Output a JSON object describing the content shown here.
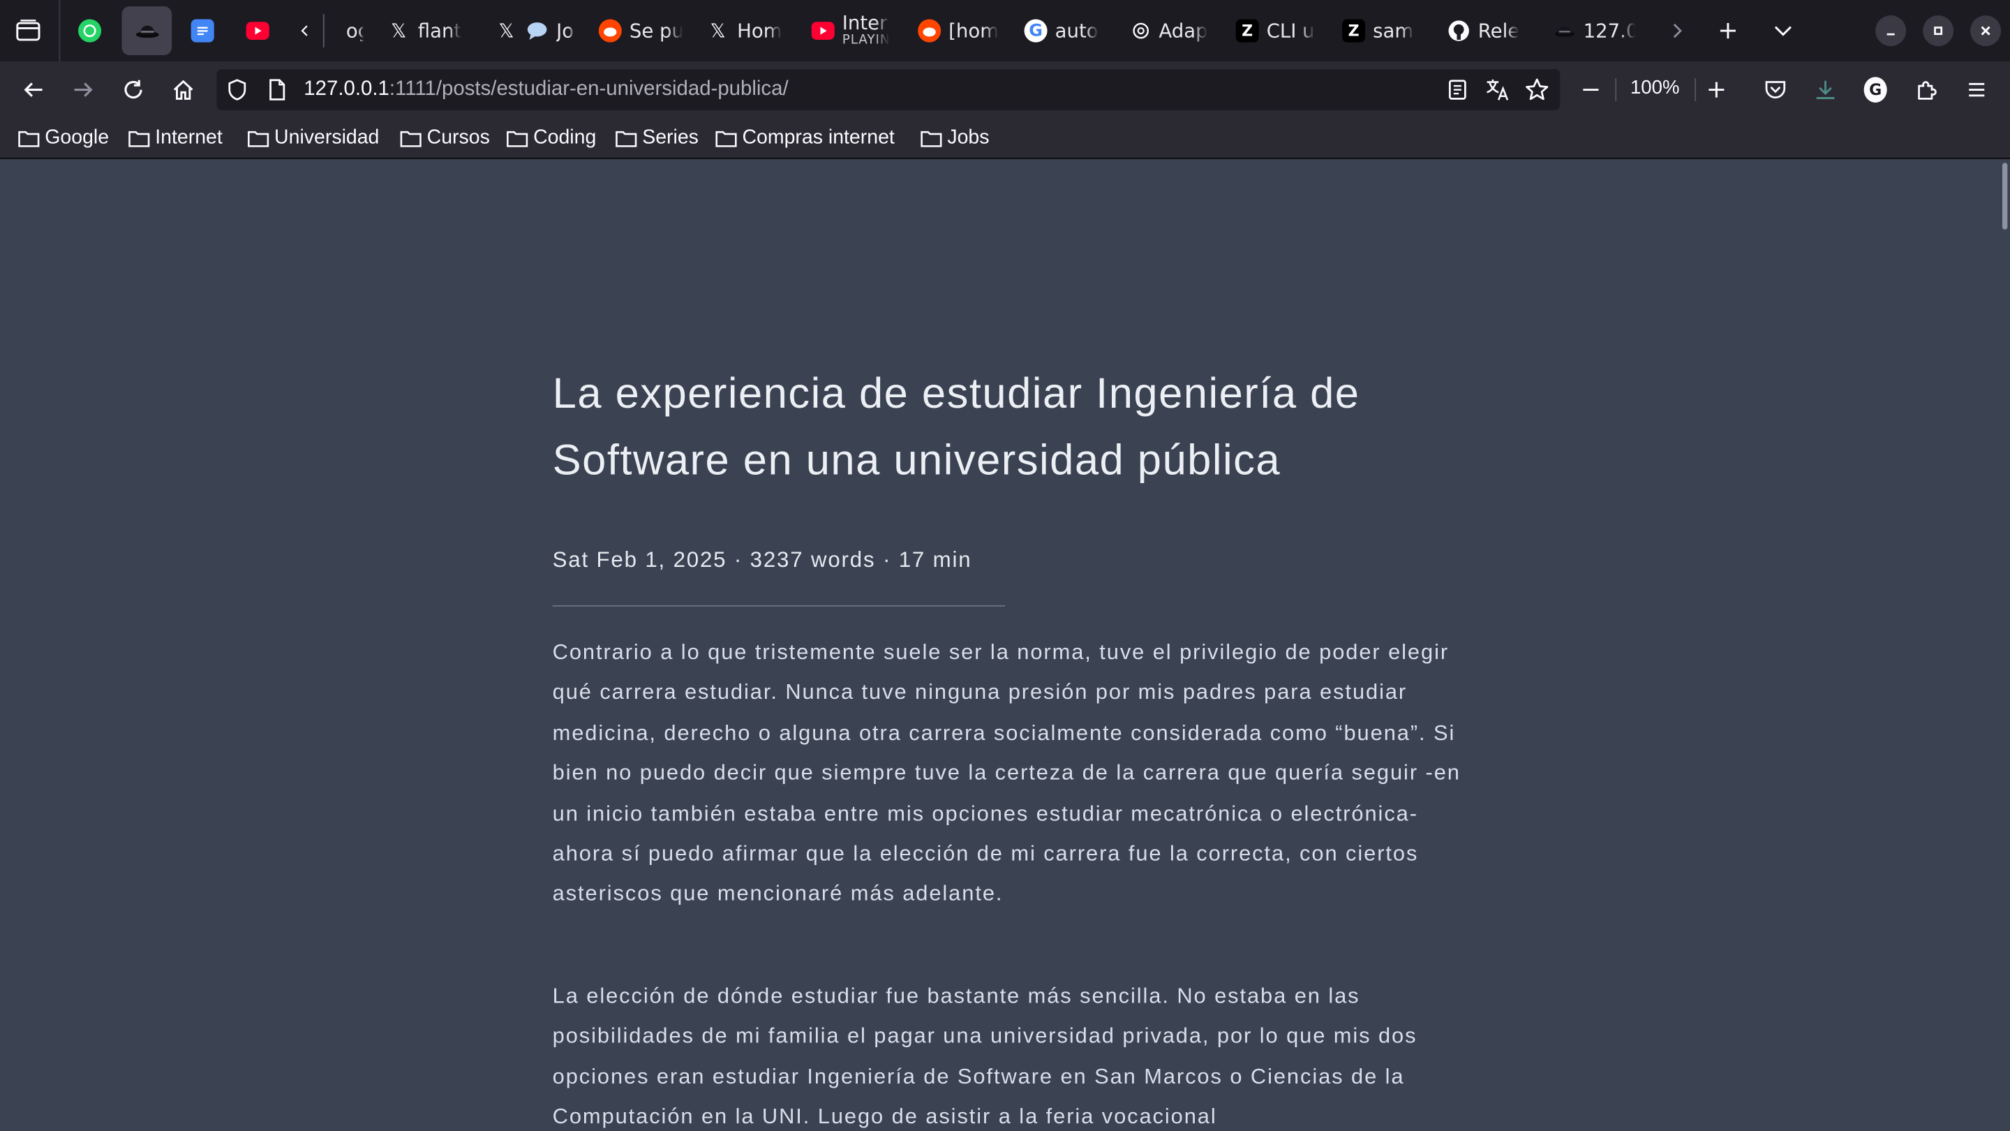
{
  "tabs": [
    {
      "id": "whatsapp",
      "title": "",
      "icon": "whatsapp-icon"
    },
    {
      "id": "local-active",
      "title": "",
      "icon": "hat-icon"
    },
    {
      "id": "docs",
      "title": "",
      "icon": "google-docs-icon"
    },
    {
      "id": "youtube",
      "title": "",
      "icon": "youtube-icon"
    },
    {
      "id": "blog",
      "title": "og",
      "icon": "chevron-left-icon"
    },
    {
      "id": "x-flant",
      "title": "flant",
      "icon": "x-icon"
    },
    {
      "id": "x-jo",
      "title": "Jo",
      "icon": "x-icon"
    },
    {
      "id": "reddit-se",
      "title": "Se pu",
      "icon": "reddit-icon"
    },
    {
      "id": "x-home",
      "title": "Hom",
      "icon": "x-icon"
    },
    {
      "id": "youtube-playing",
      "title": "Inter",
      "subtitle": "PLAYIN",
      "icon": "youtube-icon"
    },
    {
      "id": "reddit-home",
      "title": "[hom",
      "icon": "reddit-icon"
    },
    {
      "id": "google-auto",
      "title": "auto",
      "icon": "google-icon"
    },
    {
      "id": "openai-adap",
      "title": "Adap",
      "icon": "openai-icon"
    },
    {
      "id": "z-cli",
      "title": "CLI u",
      "icon": "z-icon"
    },
    {
      "id": "z-sam",
      "title": "sam",
      "icon": "z-icon"
    },
    {
      "id": "github",
      "title": "Rele",
      "icon": "github-icon"
    },
    {
      "id": "local-127",
      "title": "127.0",
      "icon": "hat-icon"
    }
  ],
  "nav": {
    "url_host": "127.0.0.1",
    "url_rest": ":1111/posts/estudiar-en-universidad-publica/",
    "zoom": "100%"
  },
  "bookmarks": [
    "Google",
    "Internet",
    "Universidad",
    "Cursos",
    "Coding",
    "Series",
    "Compras internet",
    "Jobs"
  ],
  "article": {
    "title": "La experiencia de estudiar Ingeniería de Software en una universidad pública",
    "meta": "Sat Feb 1, 2025 · 3237 words · 17 min",
    "paragraphs": [
      "Contrario a lo que tristemente suele ser la norma, tuve el privilegio de poder elegir qué carrera estudiar. Nunca tuve ninguna presión por mis padres para estudiar medicina, derecho o alguna otra carrera socialmente considerada como “buena”. Si bien no puedo decir que siempre tuve la certeza de la carrera que quería seguir -en un inicio también estaba entre mis opciones estudiar mecatrónica o electrónica- ahora sí puedo afirmar que la elección de mi carrera fue la correcta, con ciertos asteriscos que mencionaré más adelante.",
      "La elección de dónde estudiar fue bastante más sencilla. No estaba en las posibilidades de mi familia el pagar una universidad privada, por lo que mis dos opciones eran estudiar Ingeniería de Software en San Marcos o Ciencias de la Computación en la UNI. Luego de asistir a la feria vocacional"
    ]
  },
  "colors": {
    "page_bg": "#3b4252",
    "tabbar_bg": "#1c1b22",
    "toolbar_bg": "#2b2a33"
  }
}
